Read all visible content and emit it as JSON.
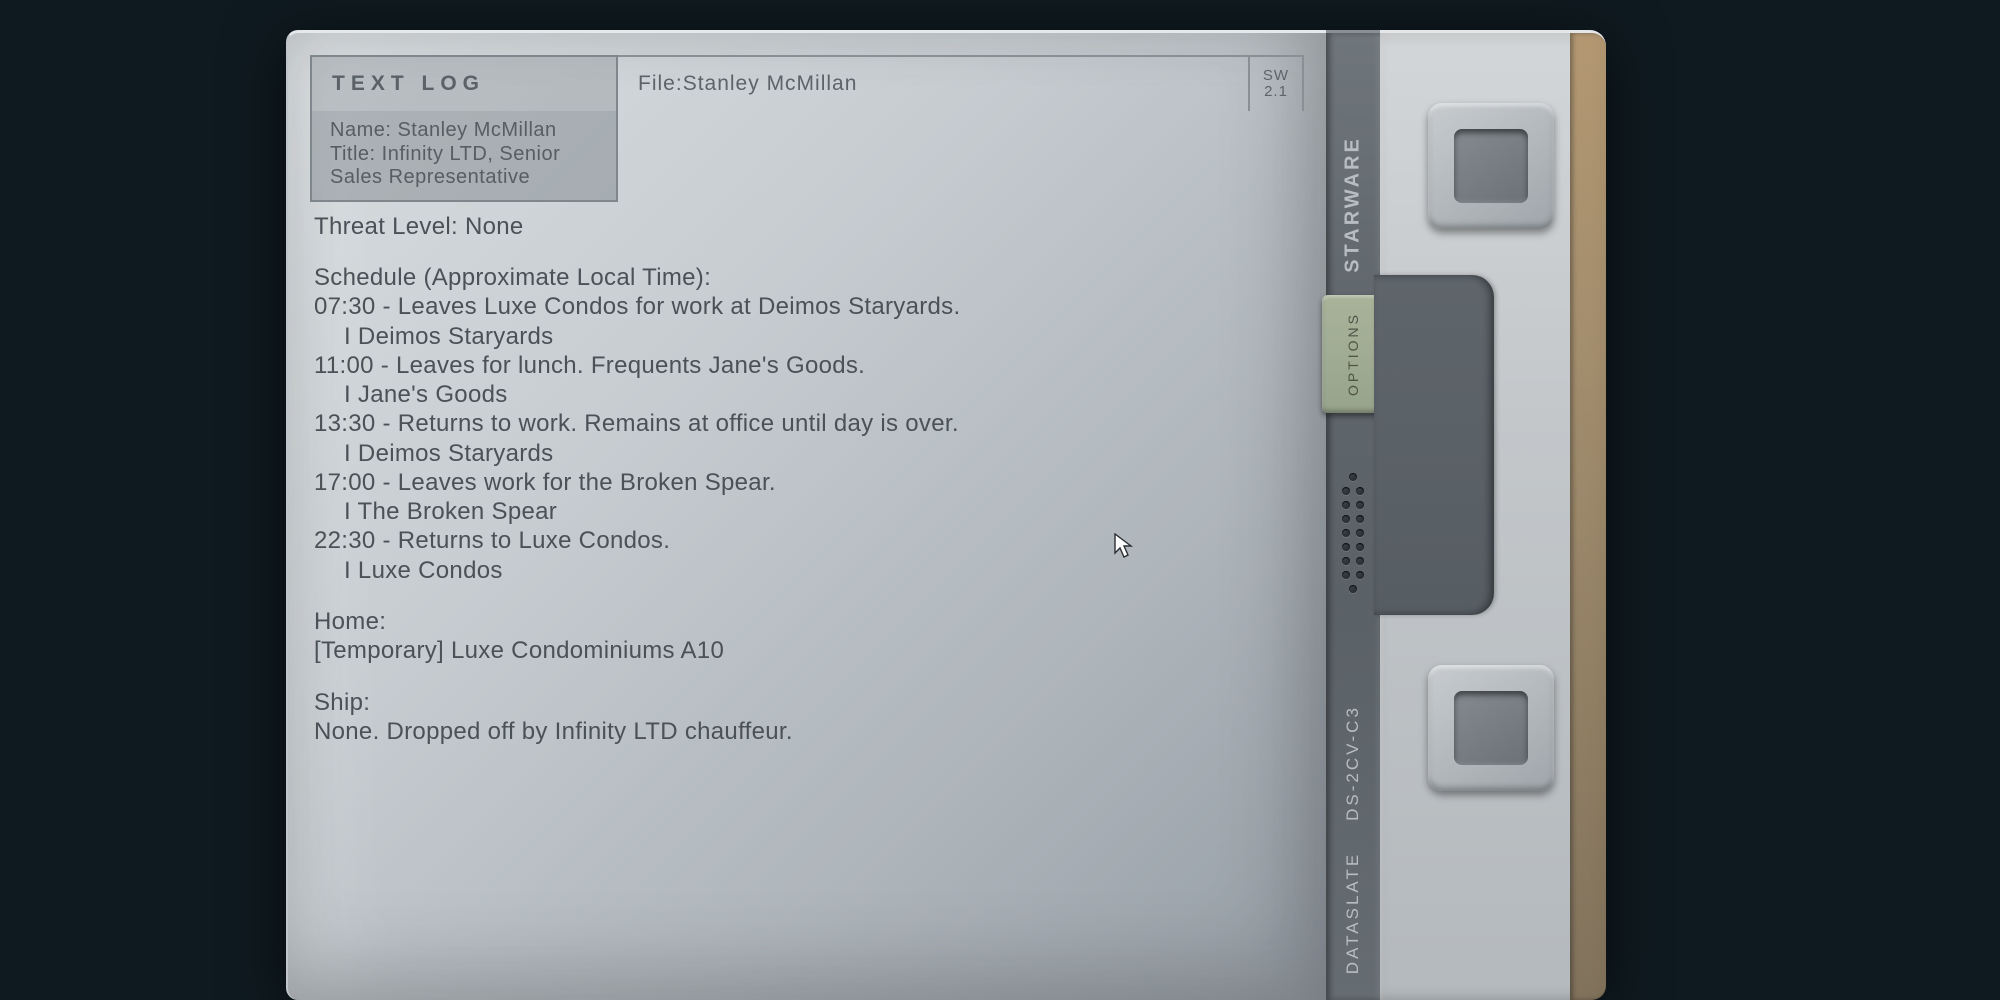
{
  "header": {
    "tab_label": "TEXT LOG",
    "file_prefix": "File: ",
    "file_name": "Stanley McMillan",
    "sw_label": "SW",
    "sw_version": "2.1"
  },
  "meta": {
    "name_label": "Name: ",
    "name": "Stanley McMillan",
    "title_label": "Title: ",
    "title": "Infinity LTD, Senior Sales Representative"
  },
  "body": {
    "threat_label": "Threat Level: ",
    "threat_value": "None",
    "schedule_heading": "Schedule (Approximate Local Time):",
    "schedule": [
      {
        "time": "07:30",
        "desc": "Leaves Luxe Condos for work at Deimos Staryards.",
        "loc": "Deimos Staryards"
      },
      {
        "time": "11:00",
        "desc": "Leaves for lunch. Frequents Jane's Goods.",
        "loc": "Jane's Goods"
      },
      {
        "time": "13:30",
        "desc": "Returns to work. Remains at office until day is over.",
        "loc": "Deimos Staryards"
      },
      {
        "time": "17:00",
        "desc": "Leaves work for the Broken Spear.",
        "loc": "The Broken Spear"
      },
      {
        "time": "22:30",
        "desc": "Returns to Luxe Condos.",
        "loc": "Luxe Condos"
      }
    ],
    "home_heading": "Home:",
    "home_value": "[Temporary] Luxe Condominiums A10",
    "ship_heading": "Ship:",
    "ship_value": "None. Dropped off by Infinity LTD chauffeur."
  },
  "hardware": {
    "brand": "STARWARE",
    "model": "DS-2CV-C3",
    "model_prefix": "DATASLATE",
    "options_label": "OPTIONS"
  }
}
